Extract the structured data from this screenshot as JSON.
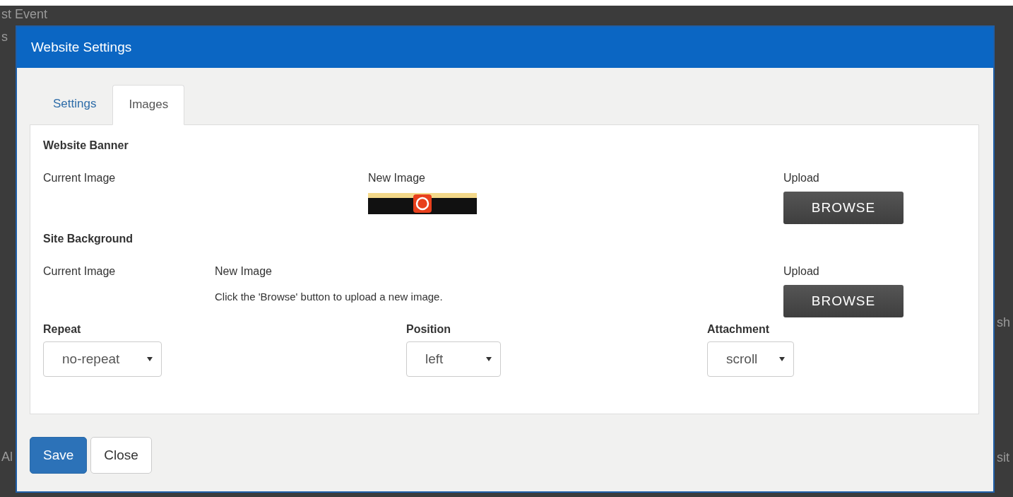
{
  "background_fragments": [
    {
      "text": "st Event"
    },
    {
      "text": "s"
    },
    {
      "text": "Al"
    },
    {
      "text": "sh"
    },
    {
      "text": "sit"
    }
  ],
  "window": {
    "title": "Website Settings"
  },
  "tabs": [
    {
      "label": "Settings",
      "selected": false
    },
    {
      "label": "Images",
      "selected": true
    }
  ],
  "banner": {
    "heading": "Website Banner",
    "current_label": "Current Image",
    "new_label": "New Image",
    "upload_label": "Upload",
    "button": "BROWSE"
  },
  "site_background": {
    "heading": "Site Background",
    "current_label": "Current Image",
    "new_label": "New Image",
    "hint": "Click the 'Browse' button to upload a new image.",
    "upload_label": "Upload",
    "button": "BROWSE"
  },
  "selects": [
    {
      "label": "Repeat",
      "value": "no-repeat"
    },
    {
      "label": "Position",
      "value": "left"
    },
    {
      "label": "Attachment",
      "value": "scroll"
    }
  ],
  "buttons": [
    {
      "label": "Save",
      "kind": "primary"
    },
    {
      "label": "Close",
      "kind": "default"
    }
  ]
}
